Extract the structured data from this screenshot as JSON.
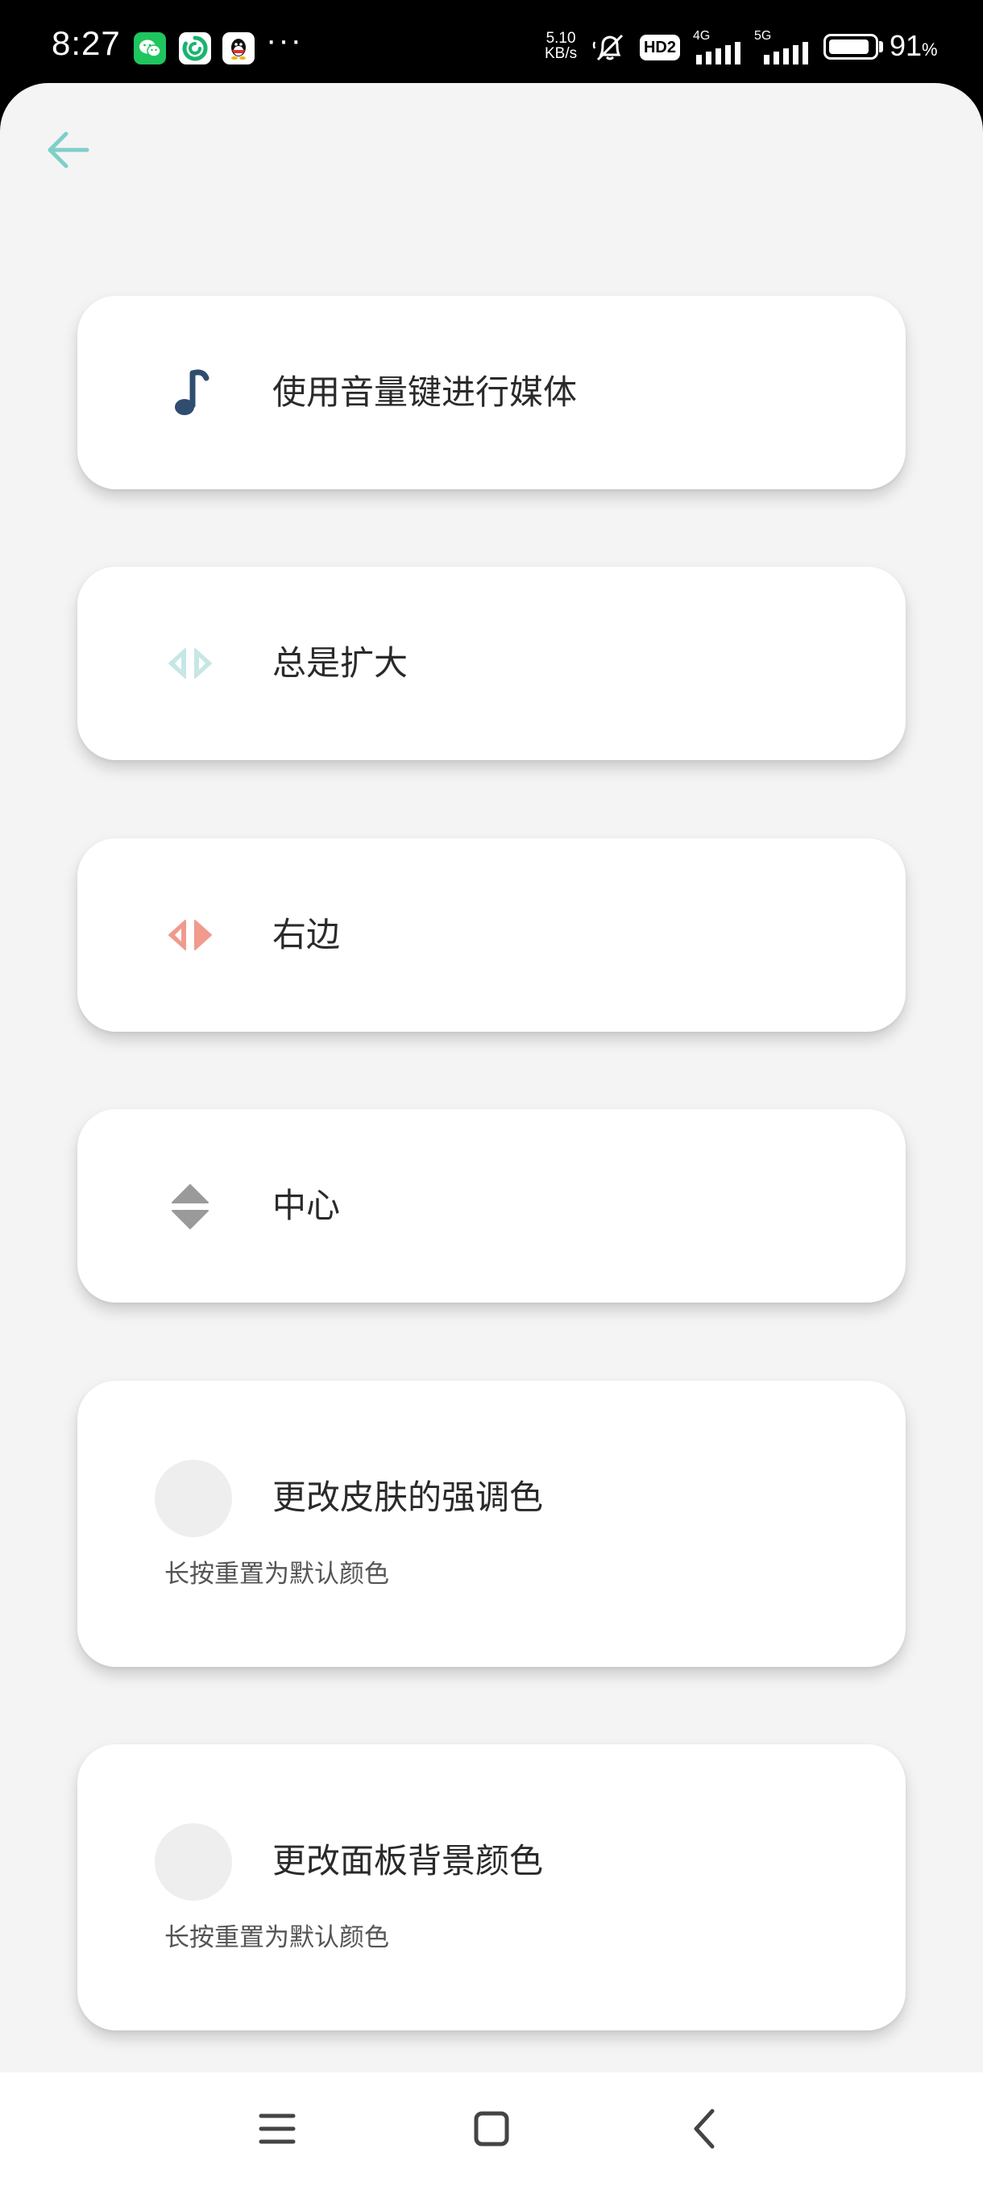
{
  "status_bar": {
    "time": "8:27",
    "apps": [
      "wechat-icon",
      "browser-icon",
      "qq-icon"
    ],
    "more": "···",
    "speed_value": "5.10",
    "speed_unit": "KB/s",
    "hd_label": "HD2",
    "net_4g": "4G",
    "net_5g": "5G",
    "battery_percent": 91,
    "battery_text": "91",
    "battery_unit": "%"
  },
  "toolbar": {
    "back_icon": "arrow-left-icon",
    "accent_color": "#7fcfc9"
  },
  "settings": [
    {
      "id": "media",
      "label": "使用音量键进行媒体",
      "icon": "music-note-icon",
      "icon_color": "#2f4d6f"
    },
    {
      "id": "expand",
      "label": "总是扩大",
      "icon": "horizontal-arrows-icon",
      "icon_color": "#c7e6e6"
    },
    {
      "id": "side",
      "label": "右边",
      "icon": "side-arrows-icon",
      "icon_color": "#f19a8e"
    },
    {
      "id": "center",
      "label": "中心",
      "icon": "vertical-arrows-icon",
      "icon_color": "#9a9a9a"
    }
  ],
  "color_options": [
    {
      "id": "accent",
      "label": "更改皮肤的强调色",
      "hint": "长按重置为默认颜色",
      "swatch_color": "#eeeeee"
    },
    {
      "id": "panel_bg",
      "label": "更改面板背景颜色",
      "hint": "长按重置为默认颜色",
      "swatch_color": "#eeeeee"
    }
  ],
  "nav_bar": {
    "buttons": [
      "menu-icon",
      "home-icon",
      "back-icon"
    ],
    "icon_color": "#444444"
  }
}
